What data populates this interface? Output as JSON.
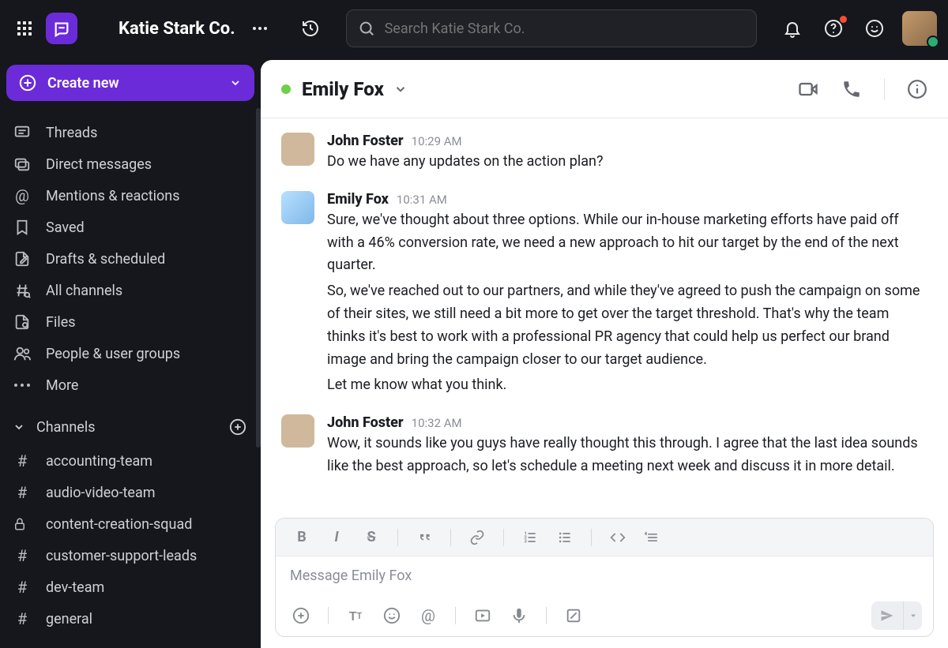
{
  "header": {
    "workspace": "Katie Stark Co.",
    "search_placeholder": "Search Katie Stark Co."
  },
  "create_button": {
    "label": "Create new"
  },
  "sidebar": {
    "items": [
      {
        "label": "Threads",
        "icon": "threads"
      },
      {
        "label": "Direct messages",
        "icon": "dm"
      },
      {
        "label": "Mentions & reactions",
        "icon": "mentions"
      },
      {
        "label": "Saved",
        "icon": "bookmark"
      },
      {
        "label": "Drafts & scheduled",
        "icon": "drafts"
      },
      {
        "label": "All channels",
        "icon": "allchannels"
      },
      {
        "label": "Files",
        "icon": "files"
      },
      {
        "label": "People & user groups",
        "icon": "people"
      },
      {
        "label": "More",
        "icon": "more"
      }
    ],
    "channels_header": "Channels",
    "channels": [
      {
        "name": "accounting-team",
        "type": "hash"
      },
      {
        "name": "audio-video-team",
        "type": "hash"
      },
      {
        "name": "content-creation-squad",
        "type": "lock"
      },
      {
        "name": "customer-support-leads",
        "type": "hash"
      },
      {
        "name": "dev-team",
        "type": "hash"
      },
      {
        "name": "general",
        "type": "hash"
      }
    ]
  },
  "chat": {
    "title": "Emily Fox",
    "messages": [
      {
        "author": "John Foster",
        "time": "10:29 AM",
        "avatar": "jf",
        "paragraphs": [
          "Do we have any updates on the action plan?"
        ]
      },
      {
        "author": "Emily Fox",
        "time": "10:31 AM",
        "avatar": "ef",
        "paragraphs": [
          "Sure, we've thought about three options. While our in-house marketing efforts have paid off with a 46% conversion rate, we need a new approach to hit our target by the end of the next quarter.",
          "So, we've reached out to our partners, and while they've agreed to push the campaign on some of their sites, we still need a bit more to get over the target threshold. That's why the team thinks it's best to work with a professional PR agency that could help us perfect our brand image and bring the campaign closer to our target audience.",
          "Let me know what you think."
        ]
      },
      {
        "author": "John Foster",
        "time": "10:32 AM",
        "avatar": "jf",
        "paragraphs": [
          "Wow, it sounds like you guys have really thought this through. I agree that the last idea sounds like the best approach, so let's schedule a meeting next week and discuss it in more detail."
        ]
      }
    ],
    "composer_placeholder": "Message Emily Fox"
  }
}
